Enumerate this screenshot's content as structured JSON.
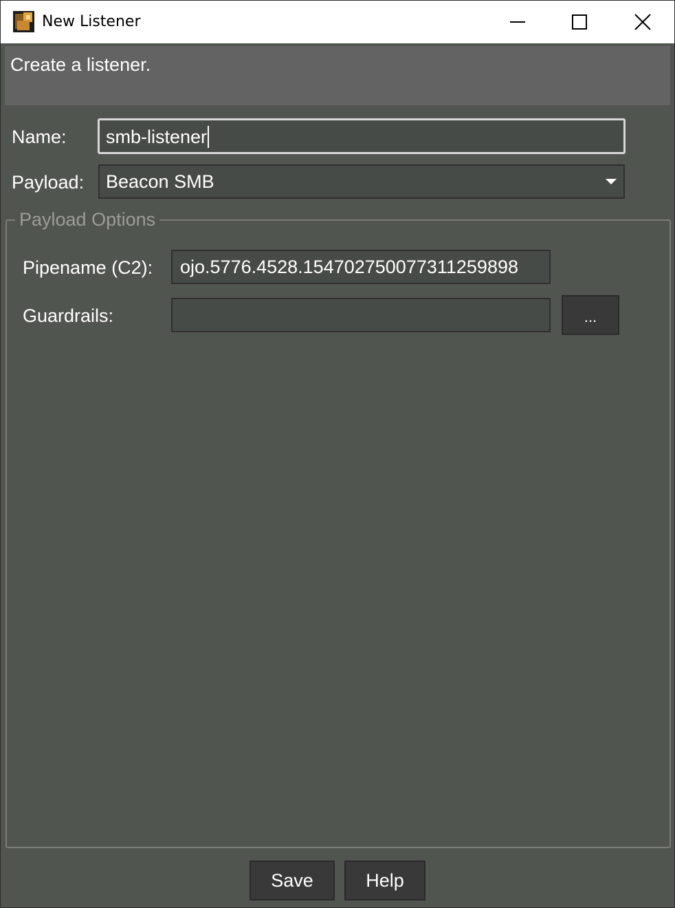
{
  "window": {
    "title": "New Listener"
  },
  "header": {
    "description": "Create a listener."
  },
  "form": {
    "name_label": "Name:",
    "name_value": "smb-listener",
    "payload_label": "Payload:",
    "payload_selected": "Beacon SMB"
  },
  "payload_options": {
    "legend": "Payload Options",
    "pipename_label": "Pipename (C2):",
    "pipename_value": "ojo.5776.4528.15470275007731125989​8",
    "guardrails_label": "Guardrails:",
    "guardrails_value": "",
    "browse_label": "..."
  },
  "footer": {
    "save_label": "Save",
    "help_label": "Help"
  }
}
